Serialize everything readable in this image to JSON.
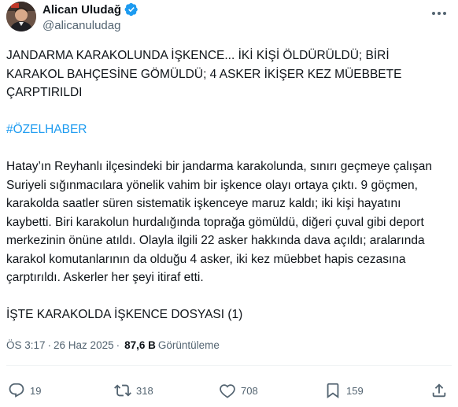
{
  "author": {
    "name": "Alican Uludağ",
    "handle": "@alicanuludag",
    "verified_color": "#1d9bf0"
  },
  "tweet": {
    "headline": "JANDARMA KARAKOLUNDA İŞKENCE... İKİ KİŞİ ÖLDÜRÜLDÜ; BİRİ KARAKOL BAHÇESİNE GÖMÜLDÜ; 4 ASKER İKİŞER KEZ MÜEBBETE ÇARPTIRILDI",
    "hashtag": "#ÖZELHABER",
    "body": "Hatay’ın Reyhanlı ilçesindeki bir jandarma karakolunda, sınırı geçmeye çalışan Suriyeli sığınmacılara yönelik vahim bir işkence olayı ortaya çıktı. 9 göçmen, karakolda saatler süren sistematik işkenceye maruz kaldı; iki kişi hayatını kaybetti. Biri karakolun hurdalığında toprağa gömüldü, diğeri çuval gibi deport merkezinin önüne atıldı. Olayla ilgili 22 asker hakkında dava açıldı; aralarında karakol komutanlarının da olduğu 4 asker, iki kez müebbet hapis cezasına çarptırıldı. Askerler her şeyi itiraf etti.",
    "footer": "İŞTE KARAKOLDA İŞKENCE DOSYASI (1)"
  },
  "meta": {
    "time": "ÖS 3:17",
    "separator": "·",
    "date": "26 Haz 2025",
    "views_count": "87,6 B",
    "views_label": "Görüntüleme"
  },
  "actions": {
    "replies": "19",
    "retweets": "318",
    "likes": "708",
    "bookmarks": "159"
  },
  "icons": [
    "more-icon",
    "verified-icon",
    "reply-icon",
    "retweet-icon",
    "like-icon",
    "bookmark-icon",
    "share-icon"
  ],
  "colors": {
    "text": "#0f1419",
    "secondary": "#536471",
    "link": "#1d9bf0"
  }
}
